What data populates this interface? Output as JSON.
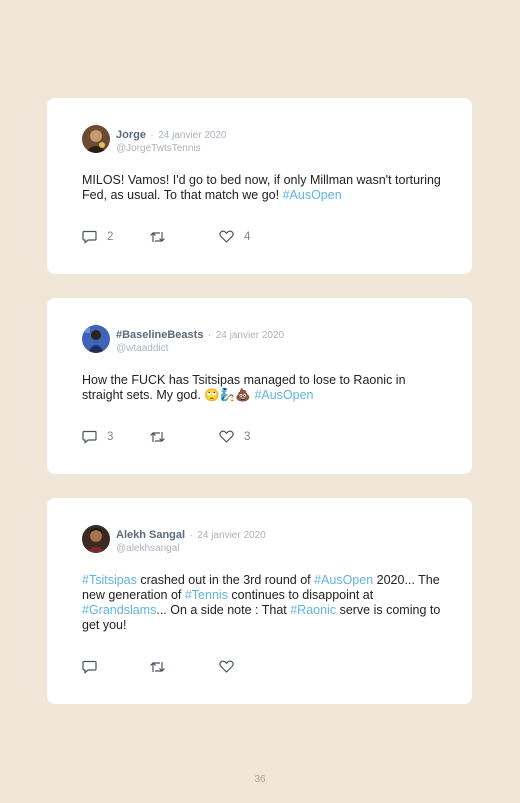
{
  "tweets": [
    {
      "name": "Jorge",
      "separator": "·",
      "date": "24 janvier 2020",
      "handle": "@JorgeTwtsTennis",
      "text_parts": [
        {
          "t": "MILOS! Vamos! I'd go to bed now, if only Millman wasn't torturing Fed, as usual. To that match we go! ",
          "tag": false
        },
        {
          "t": "#AusOpen",
          "tag": true
        }
      ],
      "reply_count": "2",
      "like_count": "4"
    },
    {
      "name": "#BaselineBeasts",
      "separator": "·",
      "date": "24 janvier 2020",
      "handle": "@wtaaddict",
      "text_parts": [
        {
          "t": "How the FUCK has Tsitsipas managed to lose to Raonic in straight sets. My god. 🙄🧞💩 ",
          "tag": false
        },
        {
          "t": "#AusOpen",
          "tag": true
        }
      ],
      "reply_count": "3",
      "like_count": "3"
    },
    {
      "name": "Alekh Sangal",
      "separator": "·",
      "date": "24 janvier 2020",
      "handle": "@alekhsangal",
      "text_parts": [
        {
          "t": "#Tsitsipas",
          "tag": true
        },
        {
          "t": " crashed out in the 3rd round of ",
          "tag": false
        },
        {
          "t": "#AusOpen",
          "tag": true
        },
        {
          "t": " 2020... The new generation of ",
          "tag": false
        },
        {
          "t": "#Tennis",
          "tag": true
        },
        {
          "t": " continues to disappoint at ",
          "tag": false
        },
        {
          "t": "#Grandslams",
          "tag": true
        },
        {
          "t": "... On a side note : That ",
          "tag": false
        },
        {
          "t": "#Raonic",
          "tag": true
        },
        {
          "t": " serve is coming to get you!",
          "tag": false
        }
      ],
      "reply_count": "",
      "like_count": ""
    }
  ],
  "icons": {
    "reply": "reply-icon",
    "retweet": "retweet-icon",
    "like": "heart-icon"
  },
  "colors": {
    "background": "#f1e7d9",
    "card": "#ffffff",
    "hashtag": "#5fb4e2",
    "name": "#5d6a7c",
    "meta": "#aab3bd"
  },
  "page_number": "36"
}
